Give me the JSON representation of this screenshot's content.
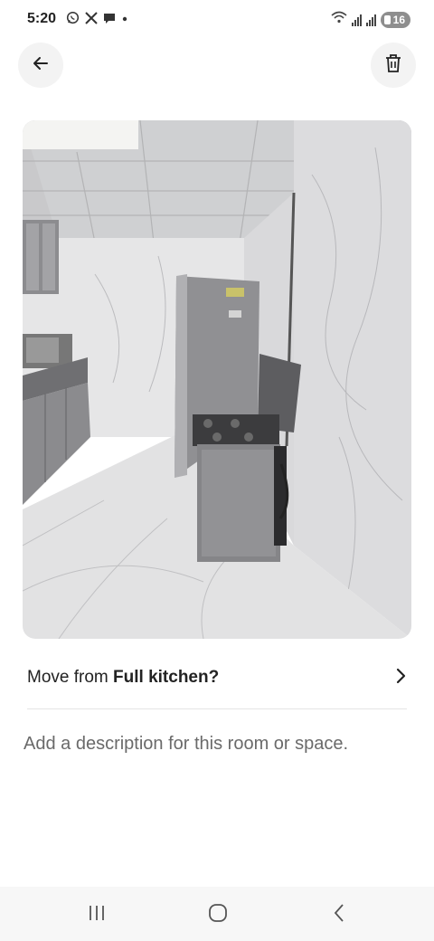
{
  "status_bar": {
    "time": "5:20",
    "left_icons": [
      "whatsapp-icon",
      "x-icon",
      "chat-bubble-icon",
      "dot-icon"
    ],
    "right_icons": [
      "wifi-icon",
      "signal-icon",
      "signal-icon",
      "battery-icon"
    ],
    "battery_level": "16"
  },
  "header": {
    "back_icon": "arrow-left-icon",
    "delete_icon": "trash-icon"
  },
  "photo": {
    "alt": "kitchen photo"
  },
  "move_row": {
    "prefix": "Move from ",
    "room": "Full kitchen",
    "suffix": "?",
    "chevron_icon": "chevron-right-icon"
  },
  "description": {
    "placeholder": "Add a description for this room or space."
  },
  "nav_bar": {
    "recents_icon": "recents-icon",
    "home_icon": "home-icon",
    "back_icon": "back-chevron-icon"
  },
  "colors": {
    "text": "#222222",
    "placeholder": "#6a6a6a",
    "button_bg": "#f3f3f3",
    "divider": "#e4e4e4"
  }
}
